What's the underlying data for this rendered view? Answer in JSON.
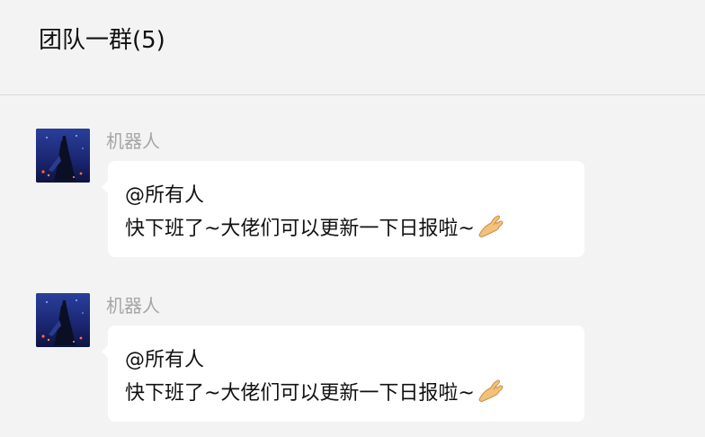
{
  "header": {
    "title": "团队一群(5)"
  },
  "messages": [
    {
      "sender": "机器人",
      "mention": "@所有人",
      "text": "快下班了~大佬们可以更新一下日报啦~",
      "emoji": "ok-hand-emoji"
    },
    {
      "sender": "机器人",
      "mention": "@所有人",
      "text": "快下班了~大佬们可以更新一下日报啦~",
      "emoji": "ok-hand-emoji"
    }
  ],
  "colors": {
    "background": "#f3f3f3",
    "bubble": "#ffffff",
    "sender_name": "#a6a6a6",
    "text": "#111111",
    "divider": "#d9d9d9"
  }
}
